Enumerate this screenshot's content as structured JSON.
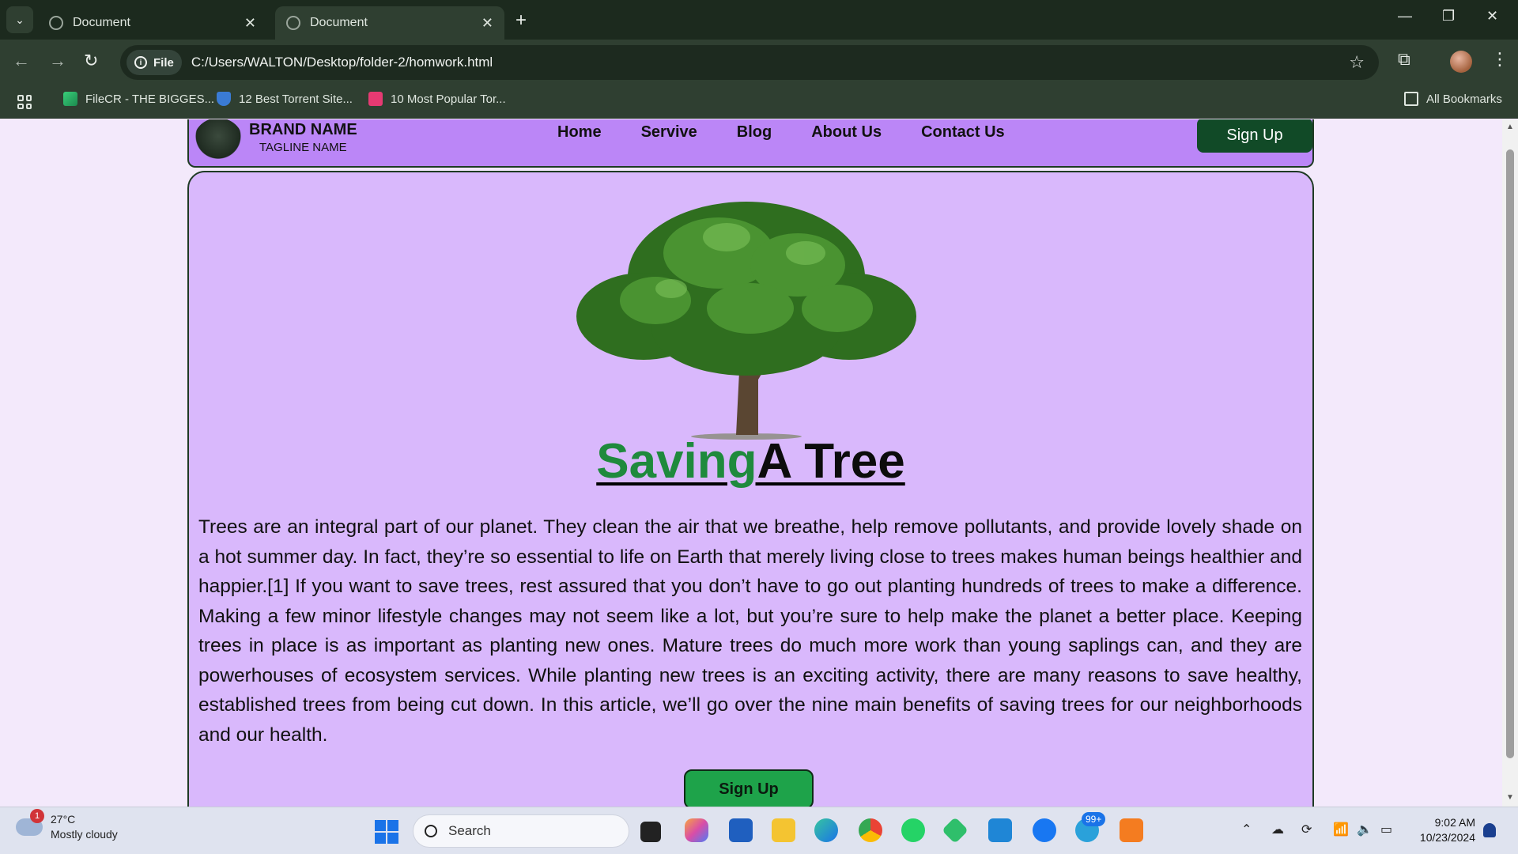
{
  "browser": {
    "tabs": [
      {
        "title": "Document",
        "active": false
      },
      {
        "title": "Document",
        "active": true
      }
    ],
    "address": {
      "scheme_chip": "File",
      "url": "C:/Users/WALTON/Desktop/folder-2/homwork.html"
    },
    "bookmarks": [
      {
        "label": "FileCR - THE BIGGES...",
        "icon": "filecr-icon"
      },
      {
        "label": "12 Best Torrent Site...",
        "icon": "shield-icon"
      },
      {
        "label": "10 Most Popular Tor...",
        "icon": "tf-icon"
      }
    ],
    "all_bookmarks_label": "All Bookmarks"
  },
  "site": {
    "brand_name": "BRAND NAME",
    "tagline": "TAGLINE NAME",
    "nav": [
      "Home",
      "Servive",
      "Blog",
      "About Us",
      "Contact Us"
    ],
    "header_signup": "Sign Up",
    "title_part1": "Saving",
    "title_part2": "A Tree",
    "paragraph": "Trees are an integral part of our planet. They clean the air that we breathe, help remove pollutants, and provide lovely shade on a hot summer day. In fact, they’re so essential to life on Earth that merely living close to trees makes human beings healthier and happier.[1] If you want to save trees, rest assured that you don’t have to go out planting hundreds of trees to make a difference. Making a few minor lifestyle changes may not seem like a lot, but you’re sure to help make the planet a better place. Keeping trees in place is as important as planting new ones. Mature trees do much more work than young saplings can, and they are powerhouses of ecosystem services. While planting new trees is an exciting activity, there are many reasons to save healthy, established trees from being cut down. In this article, we’ll go over the nine main benefits of saving trees for our neighborhoods and our health.",
    "cta_signup": "Sign Up",
    "colors": {
      "header_bg": "#bb86f7",
      "card_bg": "#d9b8fc",
      "accent_green": "#1f8a3d",
      "button_dark": "#114a27"
    }
  },
  "taskbar": {
    "weather_temp": "27°C",
    "weather_desc": "Mostly cloudy",
    "weather_badge": "1",
    "search_placeholder": "Search",
    "telegram_badge": "99+",
    "time": "9:02 AM",
    "date": "10/23/2024"
  }
}
